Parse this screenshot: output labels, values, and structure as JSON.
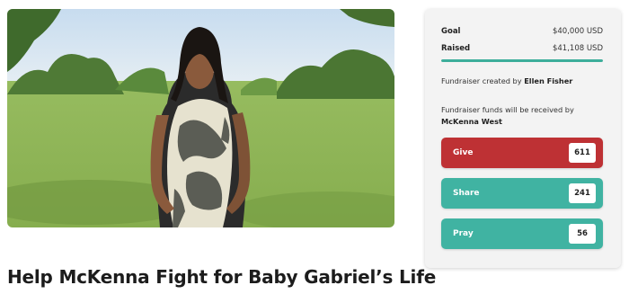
{
  "campaign": {
    "title": "Help McKenna Fight for Baby Gabriel’s Life"
  },
  "summary": {
    "goal_label": "Goal",
    "goal_value": "$40,000 USD",
    "raised_label": "Raised",
    "raised_value": "$41,108 USD",
    "progress_fraction": 1.0,
    "created_prefix": "Fundraiser created by",
    "organizer": "Ellen Fisher",
    "recipient_prefix": "Fundraiser funds will be received by",
    "recipient": "McKenna West"
  },
  "actions": [
    {
      "label": "Give",
      "count": "611",
      "color": "#be3134"
    },
    {
      "label": "Share",
      "count": "241",
      "color": "#40b3a2"
    },
    {
      "label": "Pray",
      "count": "56",
      "color": "#40b3a2"
    }
  ],
  "colors": {
    "accent": "#3dae9b",
    "give": "#be3134"
  }
}
